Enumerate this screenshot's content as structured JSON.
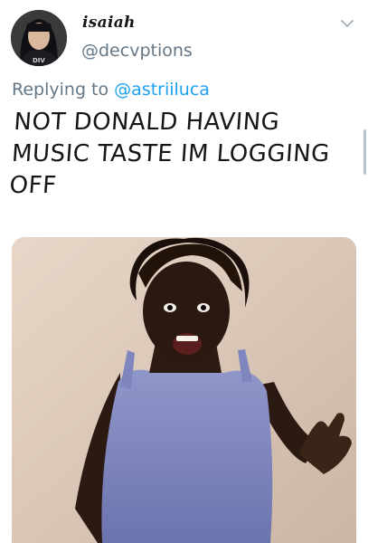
{
  "author": {
    "display_name": "isaiah",
    "handle": "@decvptions"
  },
  "reply": {
    "prefix": "Replying to",
    "mention": "@astriiluca"
  },
  "tweet": {
    "lines": [
      "NOT DONALD HAVING",
      "MUSIC TASTE IM LOGGING",
      "OFF"
    ]
  },
  "colors": {
    "text": "#14171a",
    "secondary": "#657786",
    "link": "#1da1f2"
  },
  "icons": {
    "menu": "chevron-down-icon"
  }
}
